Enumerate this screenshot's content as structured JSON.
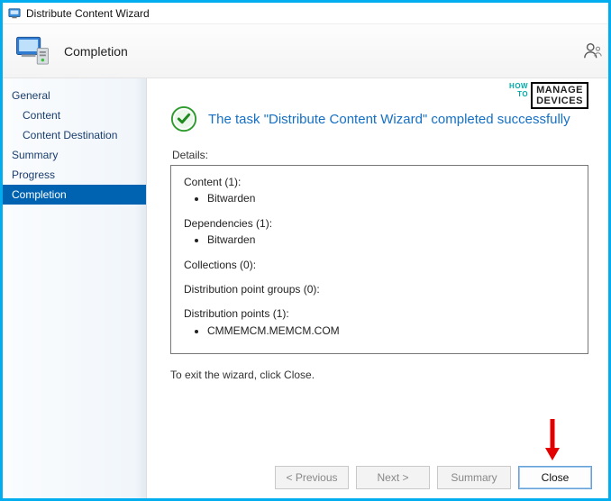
{
  "window": {
    "title": "Distribute Content Wizard"
  },
  "header": {
    "title": "Completion"
  },
  "sidebar": {
    "items": [
      {
        "label": "General"
      },
      {
        "label": "Content"
      },
      {
        "label": "Content Destination"
      },
      {
        "label": "Summary"
      },
      {
        "label": "Progress"
      },
      {
        "label": "Completion"
      }
    ]
  },
  "watermark": {
    "small_line1": "HOW",
    "small_line2": "TO",
    "box_line1": "MANAGE",
    "box_line2": "DEVICES"
  },
  "status": {
    "message": "The task \"Distribute Content Wizard\" completed successfully"
  },
  "details": {
    "label": "Details:",
    "content_header": "Content (1):",
    "content_item": "Bitwarden",
    "dependencies_header": "Dependencies (1):",
    "dependencies_item": "Bitwarden",
    "collections_header": "Collections (0):",
    "dpg_header": "Distribution point groups (0):",
    "dp_header": "Distribution points (1):",
    "dp_item": "CMMEMCM.MEMCM.COM"
  },
  "exit_text": "To exit the wizard, click Close.",
  "buttons": {
    "previous": "< Previous",
    "next": "Next >",
    "summary": "Summary",
    "close": "Close"
  }
}
